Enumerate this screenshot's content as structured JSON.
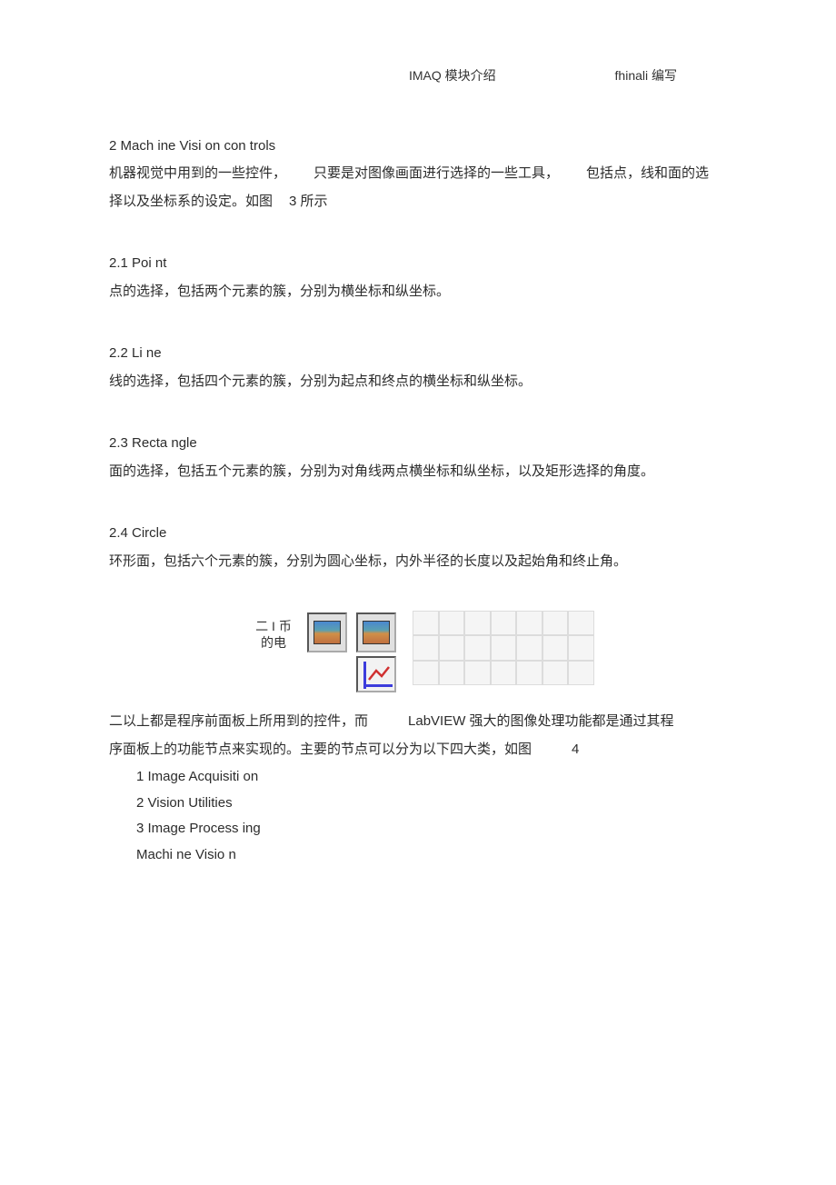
{
  "header": {
    "center": "IMAQ 模块介绍",
    "right": "fhinali 编写"
  },
  "s2": {
    "title": "2  Mach ine Visi on con trols",
    "p1a": "机器视觉中用到的一些控件，",
    "p1b": "只要是对图像画面进行选择的一些工具，",
    "p1c": "包括点，线和面的选",
    "p2a": "择以及坐标系的设定。如图",
    "p2b": "3 所示"
  },
  "s21": {
    "title": "2.1  Poi nt",
    "p": "点的选择，包括两个元素的簇，分别为横坐标和纵坐标。"
  },
  "s22": {
    "title": "2.2  Li ne",
    "p": "线的选择，包括四个元素的簇，分别为起点和终点的横坐标和纵坐标。"
  },
  "s23": {
    "title": "2.3  Recta ngle",
    "p": "面的选择，包括五个元素的簇，分别为对角线两点横坐标和纵坐标，以及矩形选择的角度。"
  },
  "s24": {
    "title": "2.4  Circle",
    "p": "环形面，包括六个元素的簇，分别为圆心坐标，内外半径的长度以及起始角和终止角。"
  },
  "figlabel": {
    "l1": "二 I 币",
    "l2": "的电"
  },
  "after": {
    "p1a": "二以上都是程序前面板上所用到的控件，而",
    "p1b": "LabVIEW 强大的图像处理功能都是通过其程",
    "p2a": "序面板上的功能节点来实现的。主要的节点可以分为以下四大类，如图",
    "p2b": "4"
  },
  "list": {
    "i1": "1  Image Acquisiti on",
    "i2": "2  Vision Utilities",
    "i3": "3  Image Process ing",
    "i4": "Machi ne Visio n"
  }
}
